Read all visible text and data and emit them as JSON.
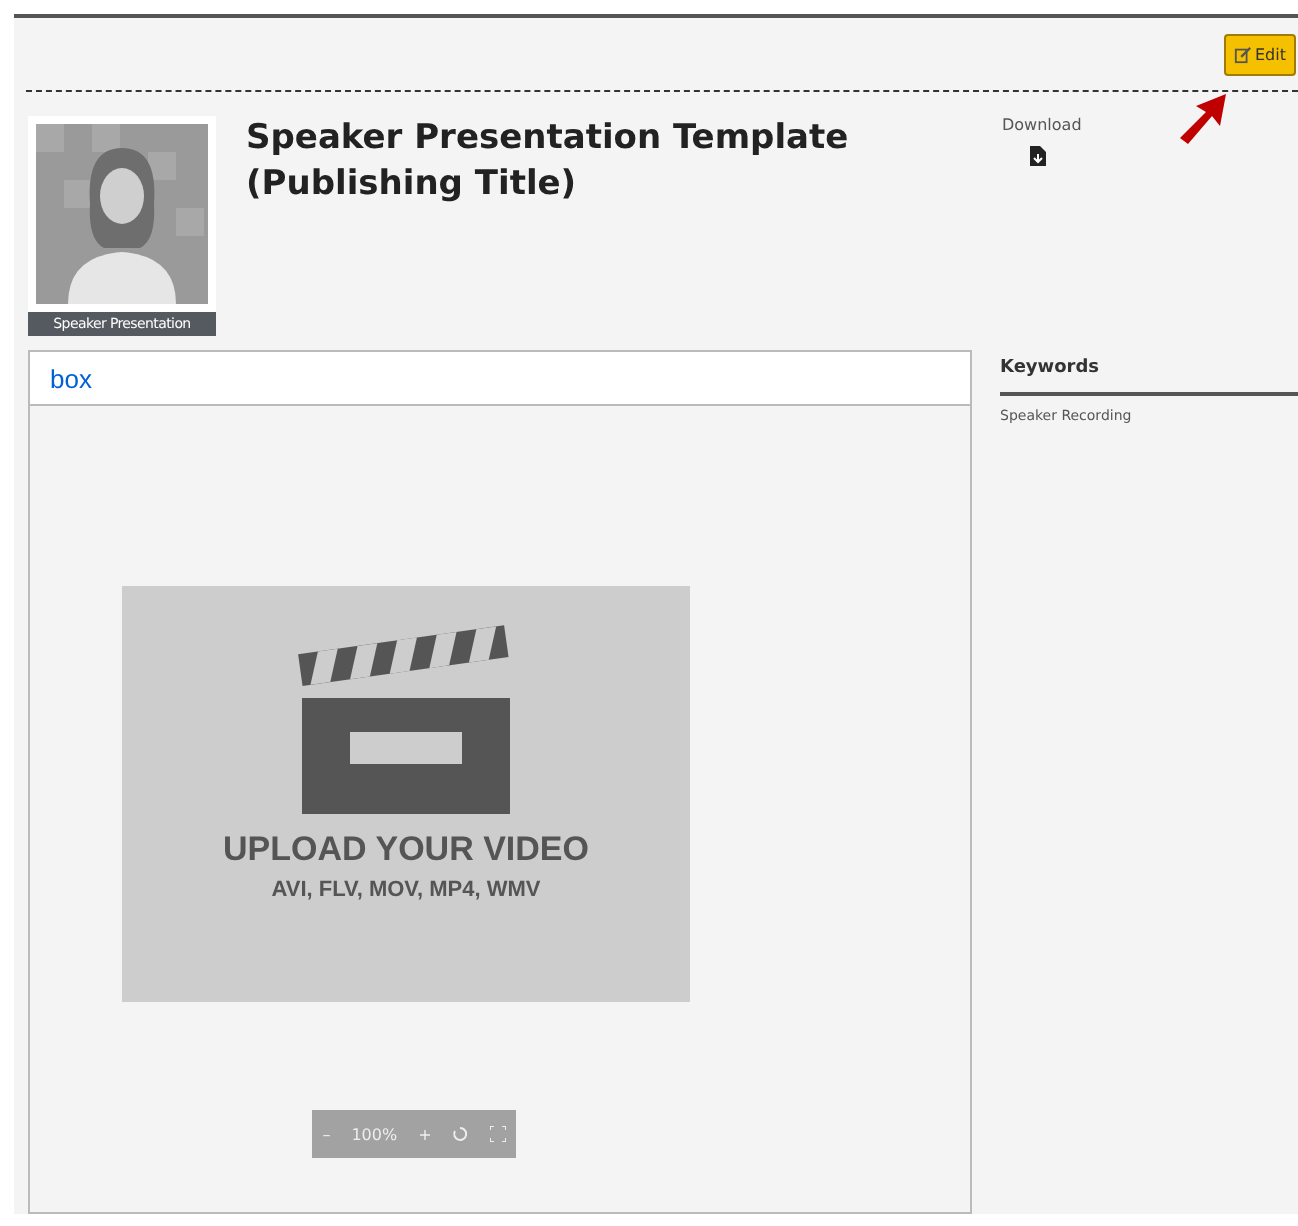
{
  "edit_button": {
    "label": "Edit"
  },
  "thumbnail": {
    "caption": "Speaker Presentation"
  },
  "title": "Speaker Presentation Template (Publishing Title)",
  "download": {
    "label": "Download"
  },
  "viewer": {
    "logo": "box",
    "placeholder_title": "UPLOAD YOUR VIDEO",
    "placeholder_formats": "AVI, FLV, MOV, MP4, WMV",
    "zoom": {
      "minus": "–",
      "value": "100%",
      "plus": "+"
    }
  },
  "keywords": {
    "heading": "Keywords",
    "items": [
      "Speaker Recording"
    ]
  }
}
